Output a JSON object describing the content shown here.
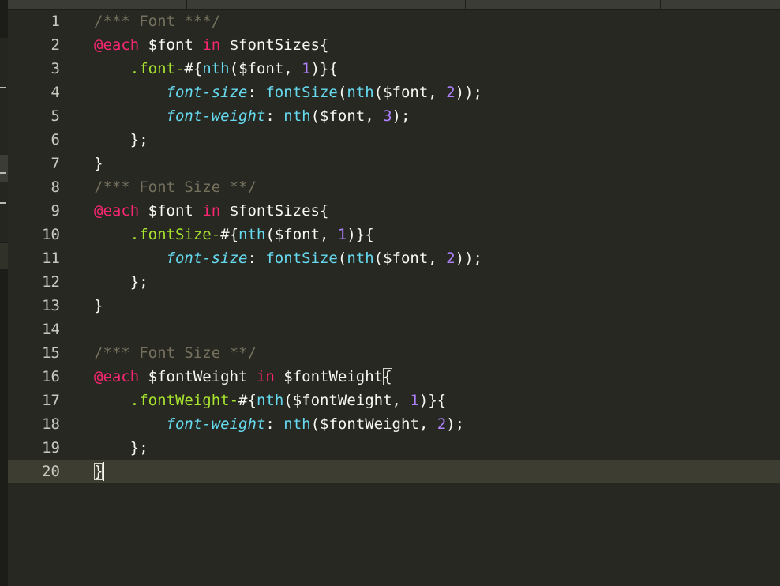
{
  "theme": {
    "background": "#272822",
    "active_line": "#3e3d32",
    "plain": "#f8f8f2",
    "comment": "#75715e",
    "keyword": "#f92672",
    "selector": "#a6e22e",
    "property": "#66d9ef",
    "function": "#66d9ef",
    "number": "#ae81ff"
  },
  "editor": {
    "language": "scss",
    "active_line": 20,
    "lines": [
      {
        "num": "1",
        "tokens": [
          {
            "t": "/*** Font ***/",
            "c": "comment"
          }
        ]
      },
      {
        "num": "2",
        "tokens": [
          {
            "t": "@each",
            "c": "keyword"
          },
          {
            "t": " $font ",
            "c": "plain"
          },
          {
            "t": "in",
            "c": "keyword"
          },
          {
            "t": " $fontSizes{",
            "c": "plain"
          }
        ]
      },
      {
        "num": "3",
        "tokens": [
          {
            "t": "    ",
            "c": "plain"
          },
          {
            "t": ".font-",
            "c": "selector"
          },
          {
            "t": "#{",
            "c": "plain"
          },
          {
            "t": "nth",
            "c": "function"
          },
          {
            "t": "($font, ",
            "c": "plain"
          },
          {
            "t": "1",
            "c": "number"
          },
          {
            "t": ")}{",
            "c": "plain"
          }
        ]
      },
      {
        "num": "4",
        "tokens": [
          {
            "t": "        ",
            "c": "plain"
          },
          {
            "t": "font-size",
            "c": "property"
          },
          {
            "t": ": ",
            "c": "plain"
          },
          {
            "t": "fontSize",
            "c": "function"
          },
          {
            "t": "(",
            "c": "plain"
          },
          {
            "t": "nth",
            "c": "function"
          },
          {
            "t": "($font, ",
            "c": "plain"
          },
          {
            "t": "2",
            "c": "number"
          },
          {
            "t": "));",
            "c": "plain"
          }
        ]
      },
      {
        "num": "5",
        "tokens": [
          {
            "t": "        ",
            "c": "plain"
          },
          {
            "t": "font-weight",
            "c": "property"
          },
          {
            "t": ": ",
            "c": "plain"
          },
          {
            "t": "nth",
            "c": "function"
          },
          {
            "t": "($font, ",
            "c": "plain"
          },
          {
            "t": "3",
            "c": "number"
          },
          {
            "t": ");",
            "c": "plain"
          }
        ]
      },
      {
        "num": "6",
        "tokens": [
          {
            "t": "    };",
            "c": "plain"
          }
        ]
      },
      {
        "num": "7",
        "tokens": [
          {
            "t": "}",
            "c": "plain"
          }
        ]
      },
      {
        "num": "8",
        "tokens": [
          {
            "t": "/*** Font Size **/",
            "c": "comment"
          }
        ]
      },
      {
        "num": "9",
        "tokens": [
          {
            "t": "@each",
            "c": "keyword"
          },
          {
            "t": " $font ",
            "c": "plain"
          },
          {
            "t": "in",
            "c": "keyword"
          },
          {
            "t": " $fontSizes{",
            "c": "plain"
          }
        ]
      },
      {
        "num": "10",
        "tokens": [
          {
            "t": "    ",
            "c": "plain"
          },
          {
            "t": ".fontSize-",
            "c": "selector"
          },
          {
            "t": "#{",
            "c": "plain"
          },
          {
            "t": "nth",
            "c": "function"
          },
          {
            "t": "($font, ",
            "c": "plain"
          },
          {
            "t": "1",
            "c": "number"
          },
          {
            "t": ")}{",
            "c": "plain"
          }
        ]
      },
      {
        "num": "11",
        "tokens": [
          {
            "t": "        ",
            "c": "plain"
          },
          {
            "t": "font-size",
            "c": "property"
          },
          {
            "t": ": ",
            "c": "plain"
          },
          {
            "t": "fontSize",
            "c": "function"
          },
          {
            "t": "(",
            "c": "plain"
          },
          {
            "t": "nth",
            "c": "function"
          },
          {
            "t": "($font, ",
            "c": "plain"
          },
          {
            "t": "2",
            "c": "number"
          },
          {
            "t": "));",
            "c": "plain"
          }
        ]
      },
      {
        "num": "12",
        "tokens": [
          {
            "t": "    };",
            "c": "plain"
          }
        ]
      },
      {
        "num": "13",
        "tokens": [
          {
            "t": "}",
            "c": "plain"
          }
        ]
      },
      {
        "num": "14",
        "tokens": []
      },
      {
        "num": "15",
        "tokens": [
          {
            "t": "/*** Font Size **/",
            "c": "comment"
          }
        ]
      },
      {
        "num": "16",
        "tokens": [
          {
            "t": "@each",
            "c": "keyword"
          },
          {
            "t": " $fontWeight ",
            "c": "plain"
          },
          {
            "t": "in",
            "c": "keyword"
          },
          {
            "t": " $fontWeight",
            "c": "plain"
          },
          {
            "t": "{",
            "c": "plain",
            "box": true
          }
        ]
      },
      {
        "num": "17",
        "tokens": [
          {
            "t": "    ",
            "c": "plain"
          },
          {
            "t": ".fontWeight-",
            "c": "selector"
          },
          {
            "t": "#{",
            "c": "plain"
          },
          {
            "t": "nth",
            "c": "function"
          },
          {
            "t": "($fontWeight, ",
            "c": "plain"
          },
          {
            "t": "1",
            "c": "number"
          },
          {
            "t": ")}{",
            "c": "plain"
          }
        ]
      },
      {
        "num": "18",
        "tokens": [
          {
            "t": "        ",
            "c": "plain"
          },
          {
            "t": "font-weight",
            "c": "property"
          },
          {
            "t": ": ",
            "c": "plain"
          },
          {
            "t": "nth",
            "c": "function"
          },
          {
            "t": "($fontWeight, ",
            "c": "plain"
          },
          {
            "t": "2",
            "c": "number"
          },
          {
            "t": ");",
            "c": "plain"
          }
        ]
      },
      {
        "num": "19",
        "tokens": [
          {
            "t": "    };",
            "c": "plain"
          }
        ]
      },
      {
        "num": "20",
        "tokens": [
          {
            "t": "}",
            "c": "plain",
            "box": true
          }
        ]
      }
    ]
  }
}
